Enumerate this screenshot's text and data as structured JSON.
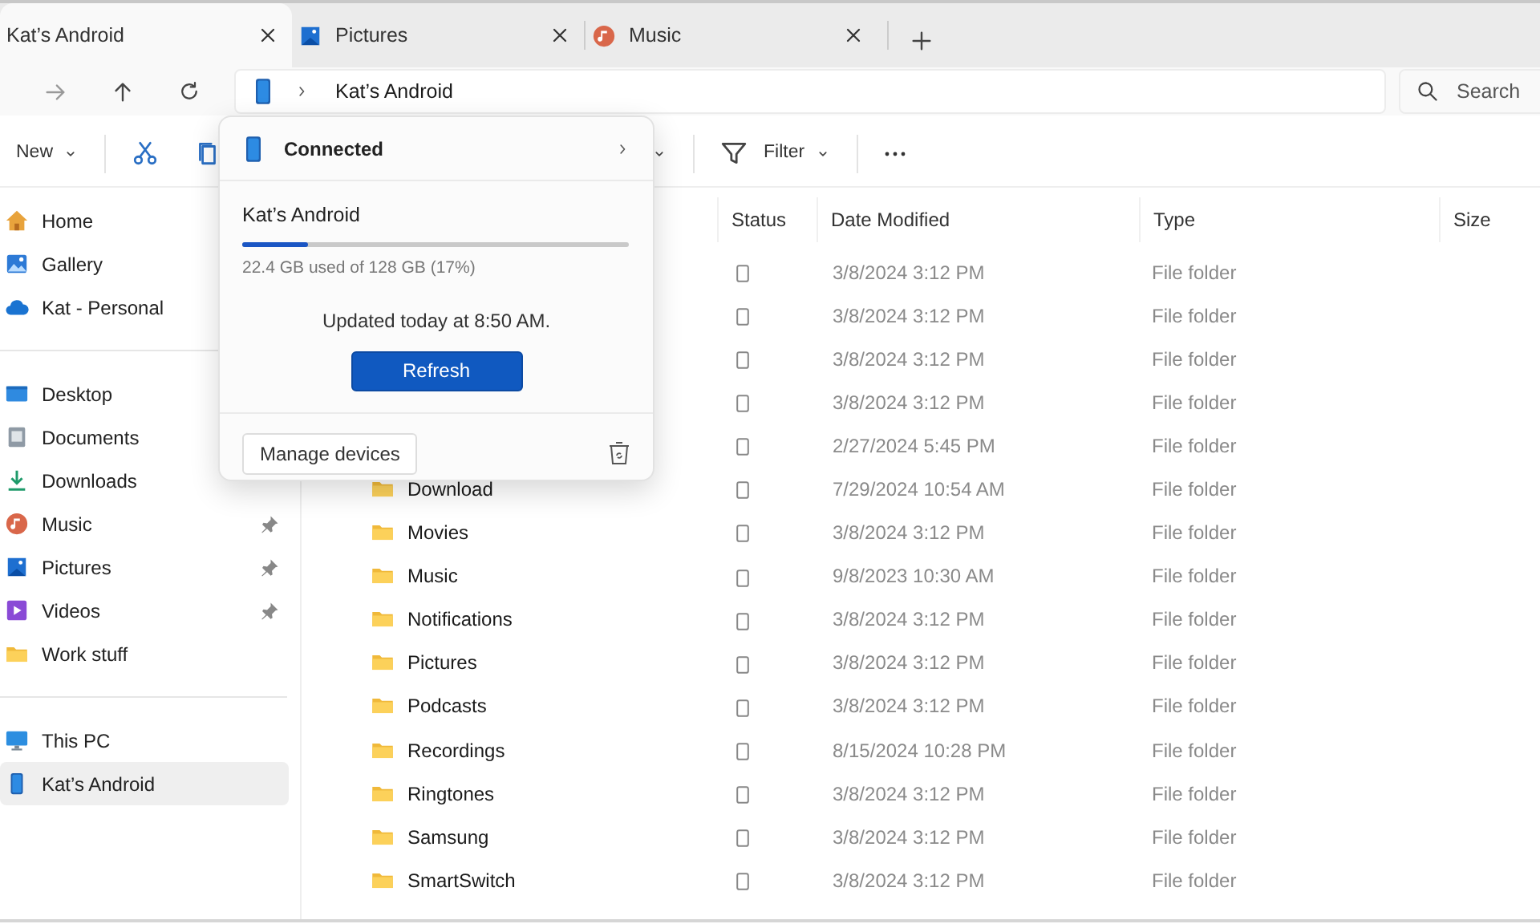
{
  "tabs": [
    {
      "label": "Kat’s Android",
      "kind": "none",
      "selected": true
    },
    {
      "label": "Pictures",
      "kind": "pictures",
      "selected": false
    },
    {
      "label": "Music",
      "kind": "music",
      "selected": false
    }
  ],
  "address": {
    "crumb": "Kat’s Android"
  },
  "search": {
    "placeholder": "Search"
  },
  "toolbar": {
    "new_label": "New",
    "filter_label": "Filter"
  },
  "sidebar": {
    "groups": [
      [
        {
          "label": "Home",
          "kind": "home",
          "pinned": false,
          "selected": false
        },
        {
          "label": "Gallery",
          "kind": "gallery",
          "pinned": false,
          "selected": false
        },
        {
          "label": "Kat - Personal",
          "kind": "cloud",
          "pinned": false,
          "selected": false
        }
      ],
      [
        {
          "label": "Desktop",
          "kind": "desktop",
          "pinned": false,
          "selected": false
        },
        {
          "label": "Documents",
          "kind": "documents",
          "pinned": false,
          "selected": false
        },
        {
          "label": "Downloads",
          "kind": "downloads",
          "pinned": false,
          "selected": false
        },
        {
          "label": "Music",
          "kind": "music",
          "pinned": true,
          "selected": false
        },
        {
          "label": "Pictures",
          "kind": "pictures",
          "pinned": true,
          "selected": false
        },
        {
          "label": "Videos",
          "kind": "videos",
          "pinned": true,
          "selected": false
        },
        {
          "label": "Work stuff",
          "kind": "folder",
          "pinned": false,
          "selected": false
        }
      ],
      [
        {
          "label": "This PC",
          "kind": "pc",
          "pinned": false,
          "selected": false
        },
        {
          "label": "Kat’s Android",
          "kind": "phone",
          "pinned": false,
          "selected": true
        }
      ]
    ]
  },
  "table": {
    "columns": [
      "Status",
      "Date Modified",
      "Type",
      "Size"
    ],
    "rows": [
      {
        "date": "3/8/2024 3:12 PM",
        "type": "File folder"
      },
      {
        "date": "3/8/2024 3:12 PM",
        "type": "File folder"
      },
      {
        "date": "3/8/2024 3:12 PM",
        "type": "File folder"
      },
      {
        "date": "3/8/2024 3:12 PM",
        "type": "File folder"
      },
      {
        "date": "2/27/2024 5:45 PM",
        "type": "File folder"
      },
      {
        "name": "Download",
        "date": "7/29/2024 10:54 AM",
        "type": "File folder"
      },
      {
        "name": "Movies",
        "date": "3/8/2024 3:12 PM",
        "type": "File folder"
      },
      {
        "name": "Music",
        "date": "9/8/2023 10:30 AM",
        "type": "File folder"
      },
      {
        "name": "Notifications",
        "date": "3/8/2024 3:12 PM",
        "type": "File folder"
      },
      {
        "name": "Pictures",
        "date": "3/8/2024 3:12 PM",
        "type": "File folder"
      },
      {
        "name": "Podcasts",
        "date": "3/8/2024 3:12 PM",
        "type": "File folder"
      },
      {
        "name": "Recordings",
        "date": "8/15/2024 10:28 PM",
        "type": "File folder"
      },
      {
        "name": "Ringtones",
        "date": "3/8/2024 3:12 PM",
        "type": "File folder"
      },
      {
        "name": "Samsung",
        "date": "3/8/2024 3:12 PM",
        "type": "File folder"
      },
      {
        "name": "SmartSwitch",
        "date": "3/8/2024 3:12 PM",
        "type": "File folder"
      }
    ]
  },
  "popup": {
    "header": "Connected",
    "device": "Kat’s Android",
    "level": 0.17,
    "usage": "22.4 GB used of 128 GB (17%)",
    "updated": "Updated today at 8:50 AM.",
    "refresh": "Refresh",
    "manage": "Manage devices"
  }
}
